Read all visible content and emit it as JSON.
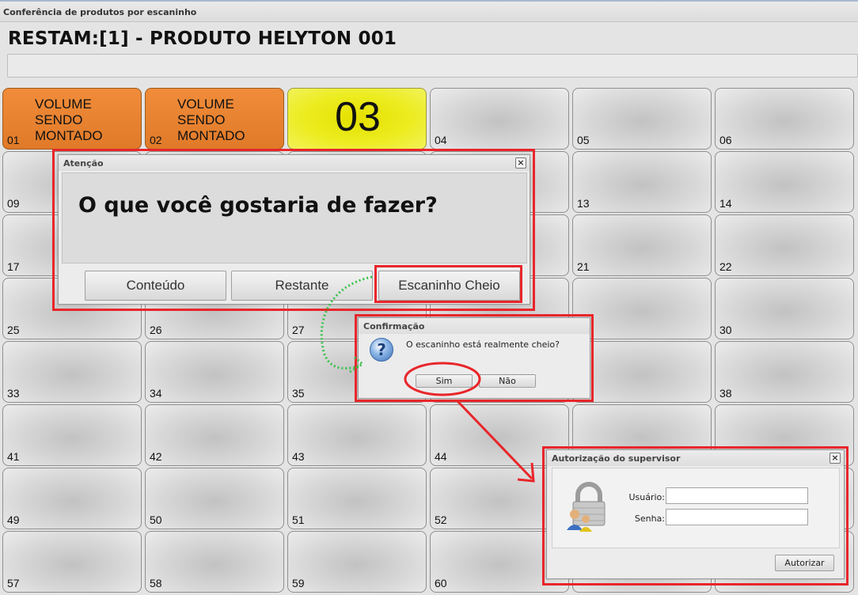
{
  "window": {
    "title": "Conferência de produtos por escaninho"
  },
  "header": {
    "title": "RESTAM:[1] - PRODUTO HELYTON 001",
    "status_text": ""
  },
  "grid": {
    "cells": [
      {
        "num": "01",
        "status": "VOLUME\nSENDO\nMONTADO",
        "color": "#e9852f"
      },
      {
        "num": "02",
        "status": "VOLUME\nSENDO\nMONTADO",
        "color": "#e9852f"
      },
      {
        "big": "03",
        "color": "#e8e61c"
      },
      {
        "num": "04"
      },
      {
        "num": "05"
      },
      {
        "num": "06"
      },
      {
        "num": "09"
      },
      {
        "num": ""
      },
      {
        "num": ""
      },
      {
        "num": ""
      },
      {
        "num": "13"
      },
      {
        "num": "14"
      },
      {
        "num": "17"
      },
      {
        "num": ""
      },
      {
        "num": ""
      },
      {
        "num": ""
      },
      {
        "num": "21"
      },
      {
        "num": "22"
      },
      {
        "num": "25"
      },
      {
        "num": "26"
      },
      {
        "num": "27"
      },
      {
        "num": ""
      },
      {
        "num": ""
      },
      {
        "num": "30"
      },
      {
        "num": "33"
      },
      {
        "num": "34"
      },
      {
        "num": "35"
      },
      {
        "num": ""
      },
      {
        "num": ""
      },
      {
        "num": "38"
      },
      {
        "num": "41"
      },
      {
        "num": "42"
      },
      {
        "num": "43"
      },
      {
        "num": "44"
      },
      {
        "num": ""
      },
      {
        "num": ""
      },
      {
        "num": "49"
      },
      {
        "num": "50"
      },
      {
        "num": "51"
      },
      {
        "num": "52"
      },
      {
        "num": ""
      },
      {
        "num": ""
      },
      {
        "num": "57"
      },
      {
        "num": "58"
      },
      {
        "num": "59"
      },
      {
        "num": "60"
      },
      {
        "num": ""
      },
      {
        "num": ""
      }
    ]
  },
  "dialog_atencao": {
    "title": "Atenção",
    "message": "O que você gostaria de fazer?",
    "buttons": [
      "Conteúdo",
      "Restante",
      "Escaninho Cheio"
    ],
    "close_icon": "close-icon"
  },
  "dialog_confirmacao": {
    "title": "Confirmação",
    "message": "O escaninho está realmente cheio?",
    "yes_label": "Sim",
    "no_label": "Não",
    "icon": "question-icon"
  },
  "dialog_autorizacao": {
    "title": "Autorização do supervisor",
    "user_label": "Usuário:",
    "password_label": "Senha:",
    "user_value": "",
    "password_value": "",
    "submit_label": "Autorizar",
    "icon": "lock-users-icon"
  },
  "annotations": {
    "highlight_color": "#e8262a",
    "arrow_green": "#38c24a",
    "arrow_red": "#e8262a"
  }
}
